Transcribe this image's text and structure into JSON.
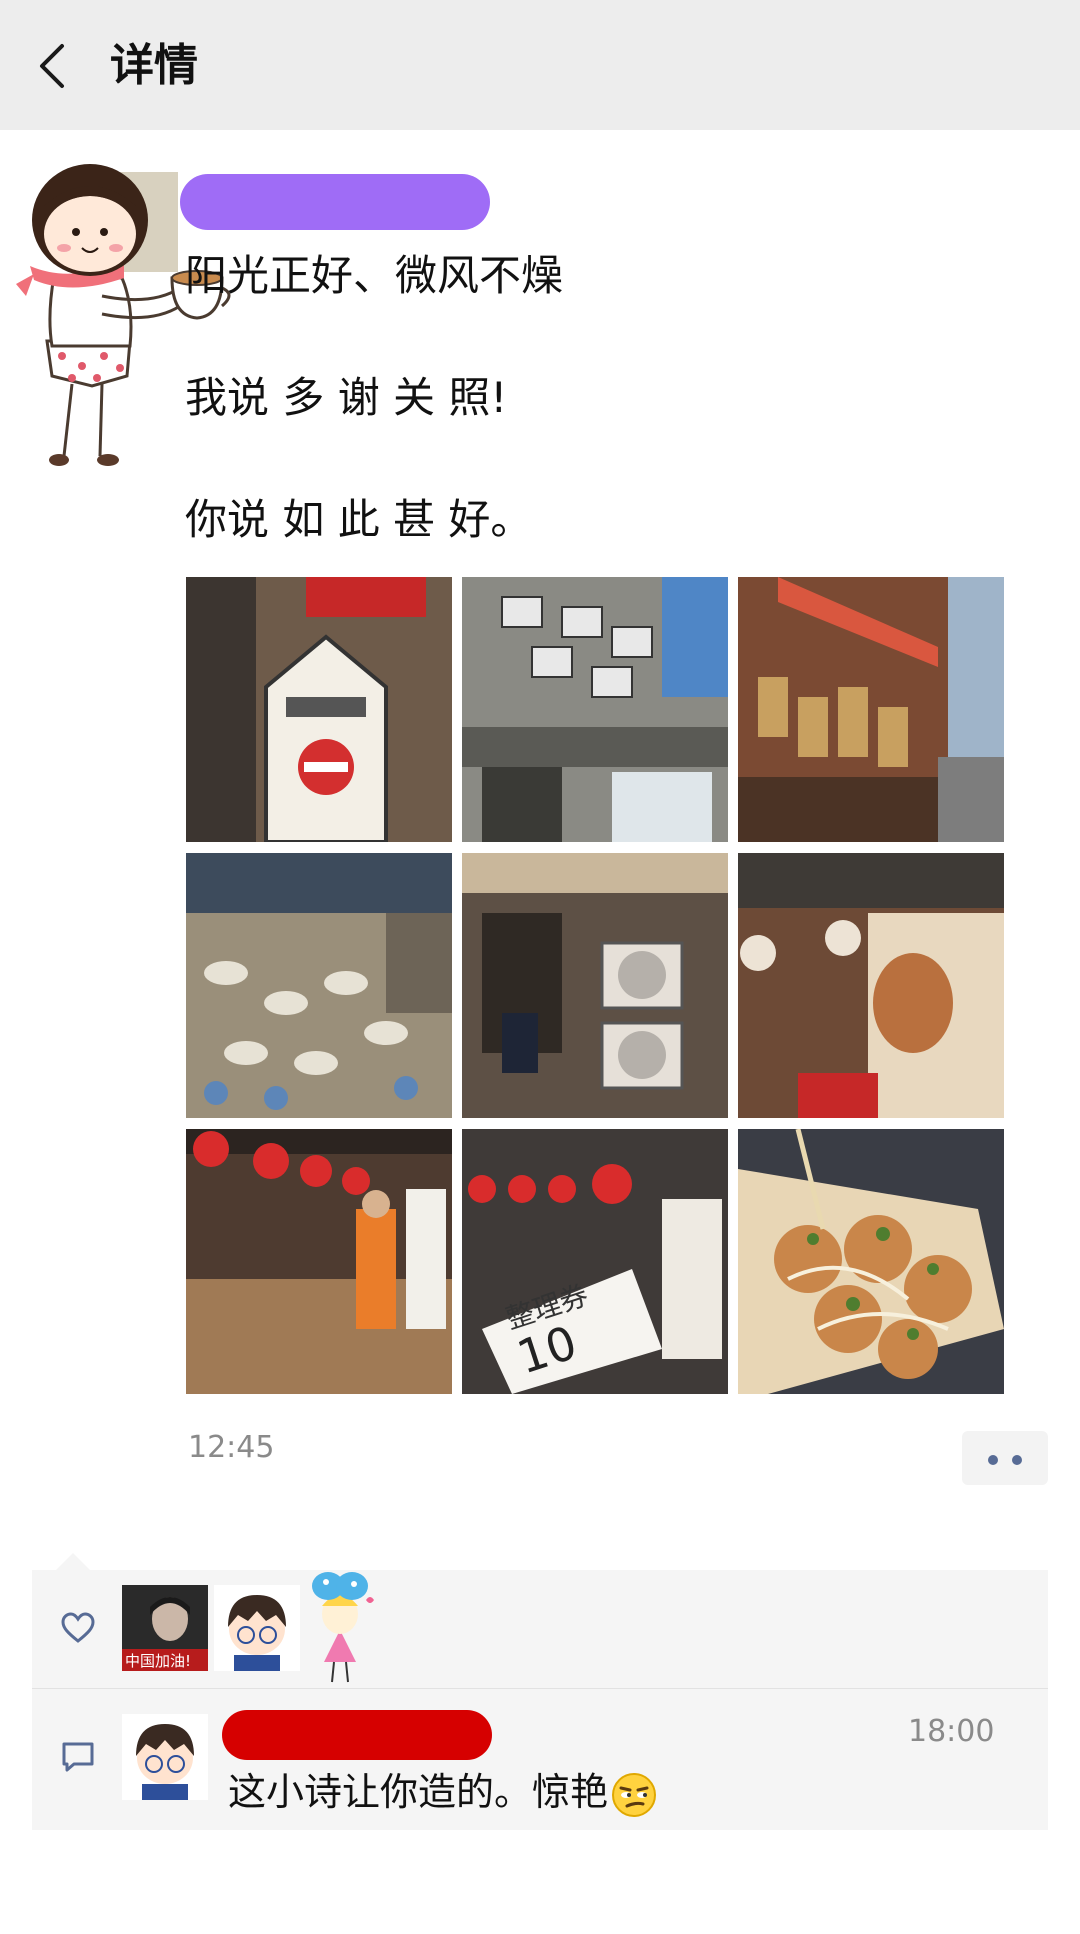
{
  "header": {
    "title": "详情"
  },
  "post": {
    "lines": [
      "阳光正好、微风不燥",
      "",
      "我说 多 谢 关 照!",
      "",
      "你说 如 此 甚 好。"
    ],
    "time": "12:45",
    "photos": [
      {
        "name": "photo-street-sign",
        "bg": "#6e5b4a",
        "accent": "#c62828"
      },
      {
        "name": "photo-building-facade",
        "bg": "#8a8a84",
        "accent": "#4f86c6"
      },
      {
        "name": "photo-shop-front",
        "bg": "#7b4a33",
        "accent": "#d9573f"
      },
      {
        "name": "photo-ceramics-market",
        "bg": "#9a8f7a",
        "accent": "#e7e2d5"
      },
      {
        "name": "photo-restaurant-entrance",
        "bg": "#5d5045",
        "accent": "#e6e0d8"
      },
      {
        "name": "photo-wooden-shop",
        "bg": "#6d4a36",
        "accent": "#e8d8bf"
      },
      {
        "name": "photo-red-lanterns-stall",
        "bg": "#4e3b30",
        "accent": "#d92c2c"
      },
      {
        "name": "photo-ticket-number",
        "bg": "#3f3a38",
        "accent": "#d92c2c"
      },
      {
        "name": "photo-takoyaki",
        "bg": "#c9ad83",
        "accent": "#4f7d2f"
      }
    ],
    "ticket_text": "整理券",
    "ticket_number": "10"
  },
  "interactions": {
    "comment": {
      "time": "18:00",
      "text": "这小诗让你造的。惊艳"
    },
    "liker_badge": "中国加油!"
  },
  "colors": {
    "header_bg": "#ededed",
    "link": "#576b95",
    "name_redaction": "#9f6cf6",
    "comment_name_redaction": "#d60000"
  }
}
